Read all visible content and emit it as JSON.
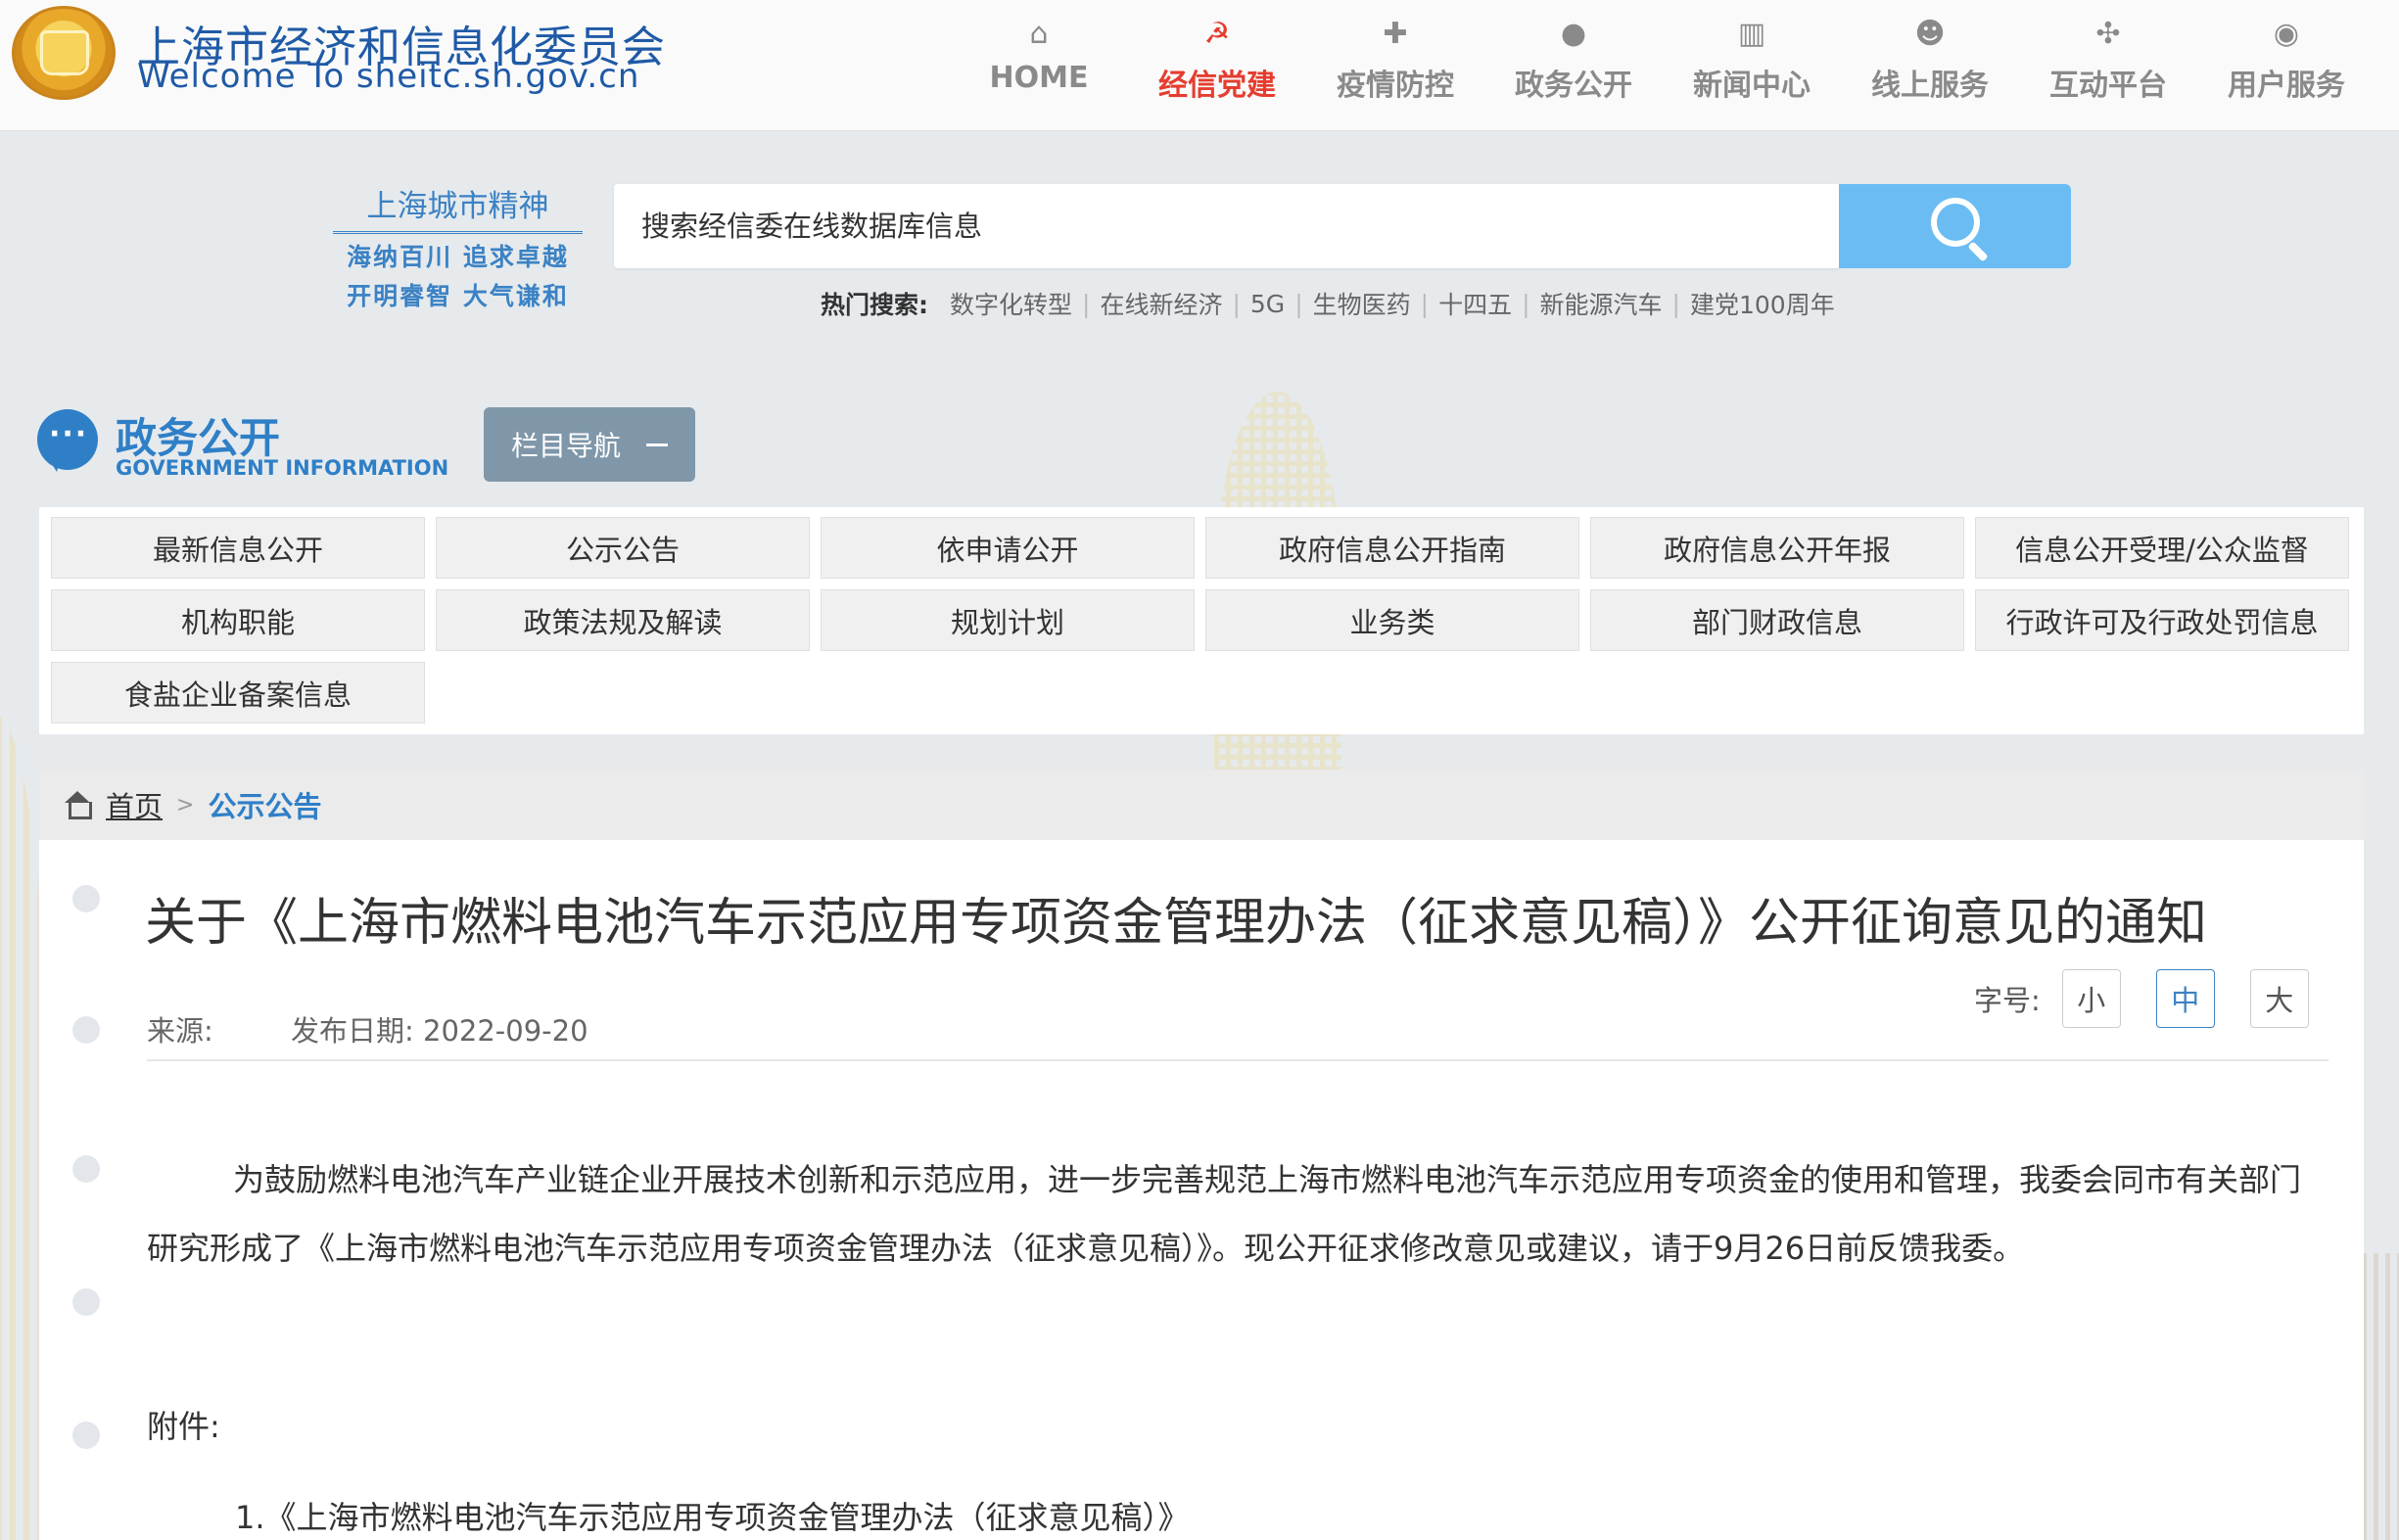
{
  "header": {
    "site_name_cn": "上海市经济和信息化委员会",
    "site_name_en": "Welcome To sheitc.sh.gov.cn",
    "nav": [
      {
        "icon": "home-icon",
        "label": "HOME",
        "active": false
      },
      {
        "icon": "party-emblem-icon",
        "label": "经信党建",
        "active": true
      },
      {
        "icon": "medical-kit-icon",
        "label": "疫情防控",
        "active": false
      },
      {
        "icon": "chat-bubble-icon",
        "label": "政务公开",
        "active": false
      },
      {
        "icon": "books-icon",
        "label": "新闻中心",
        "active": false
      },
      {
        "icon": "user-service-icon",
        "label": "线上服务",
        "active": false
      },
      {
        "icon": "interact-icon",
        "label": "互动平台",
        "active": false
      },
      {
        "icon": "support-icon",
        "label": "用户服务",
        "active": false
      }
    ],
    "active_color": "#e53d2e"
  },
  "slogan": {
    "title": "上海城市精神",
    "line1": "海纳百川 追求卓越",
    "line2": "开明睿智 大气谦和"
  },
  "search": {
    "placeholder": "搜索经信委在线数据库信息",
    "button_color": "#6bbcf3",
    "hot_label": "热门搜索:",
    "hot_items": [
      "数字化转型",
      "在线新经济",
      "5G",
      "生物医药",
      "十四五",
      "新能源汽车",
      "建党100周年"
    ]
  },
  "section": {
    "title_cn": "政务公开",
    "title_en": "GOVERNMENT INFORMATION",
    "column_nav_label": "栏目导航",
    "accent": "#2f7fc7"
  },
  "grid_links": [
    "最新信息公开",
    "公示公告",
    "依申请公开",
    "政府信息公开指南",
    "政府信息公开年报",
    "信息公开受理/公众监督",
    "机构职能",
    "政策法规及解读",
    "规划计划",
    "业务类",
    "部门财政信息",
    "行政许可及行政处罚信息",
    "食盐企业备案信息"
  ],
  "breadcrumb": {
    "home": "首页",
    "separator": ">",
    "current": "公示公告"
  },
  "article": {
    "title": "关于《上海市燃料电池汽车示范应用专项资金管理办法（征求意见稿）》公开征询意见的通知",
    "source_label": "来源:",
    "date_label": "发布日期:",
    "date": "2022-09-20",
    "fontsize_label": "字号:",
    "fontsize_options": [
      "小",
      "中",
      "大"
    ],
    "fontsize_selected": "中",
    "body": "为鼓励燃料电池汽车产业链企业开展技术创新和示范应用，进一步完善规范上海市燃料电池汽车示范应用专项资金的使用和管理，我委会同市有关部门研究形成了《上海市燃料电池汽车示范应用专项资金管理办法（征求意见稿）》。现公开征求修改意见或建议，请于9月26日前反馈我委。",
    "attachments_label": "附件:",
    "attachments": [
      "1.《上海市燃料电池汽车示范应用专项资金管理办法（征求意见稿）》"
    ]
  }
}
